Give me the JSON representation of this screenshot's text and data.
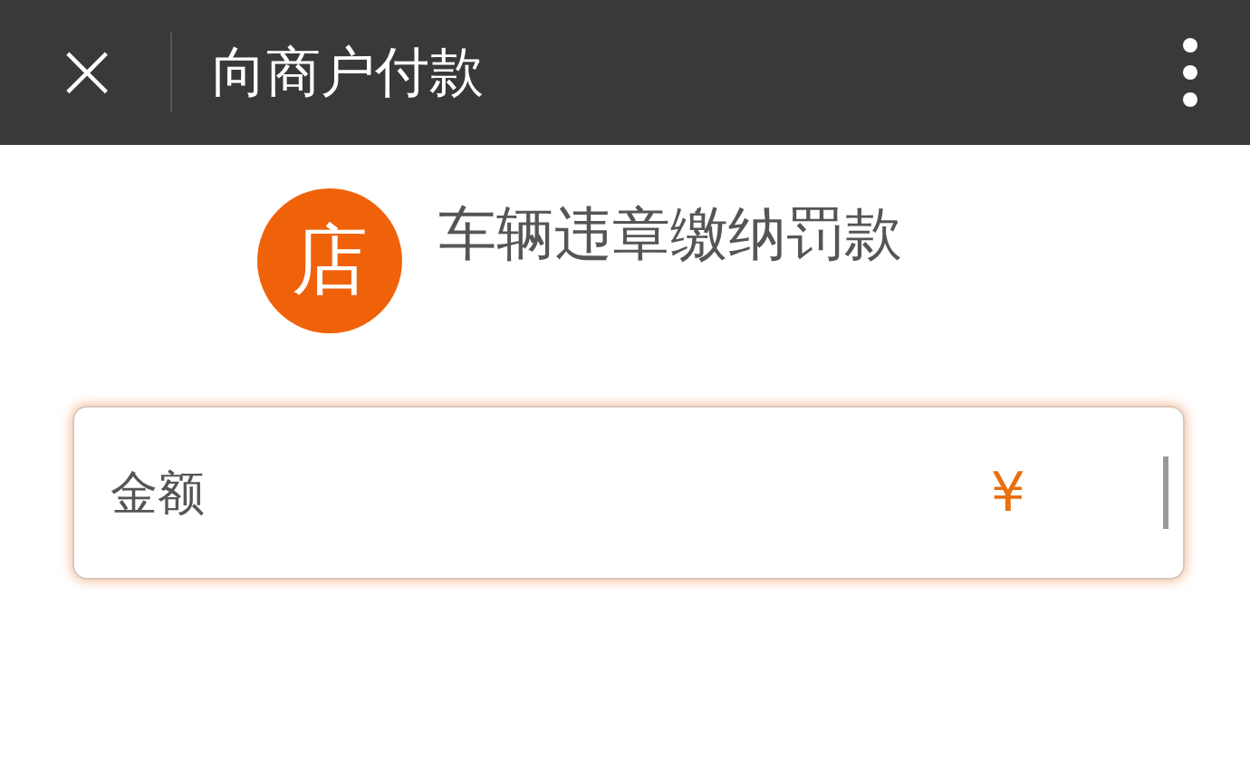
{
  "header": {
    "close_icon": "×",
    "title": "向商户付款"
  },
  "merchant": {
    "avatar": "店",
    "name": "车辆违章缴纳罚款"
  },
  "amount_field": {
    "label": "金额",
    "currency": "¥",
    "focused": true
  }
}
